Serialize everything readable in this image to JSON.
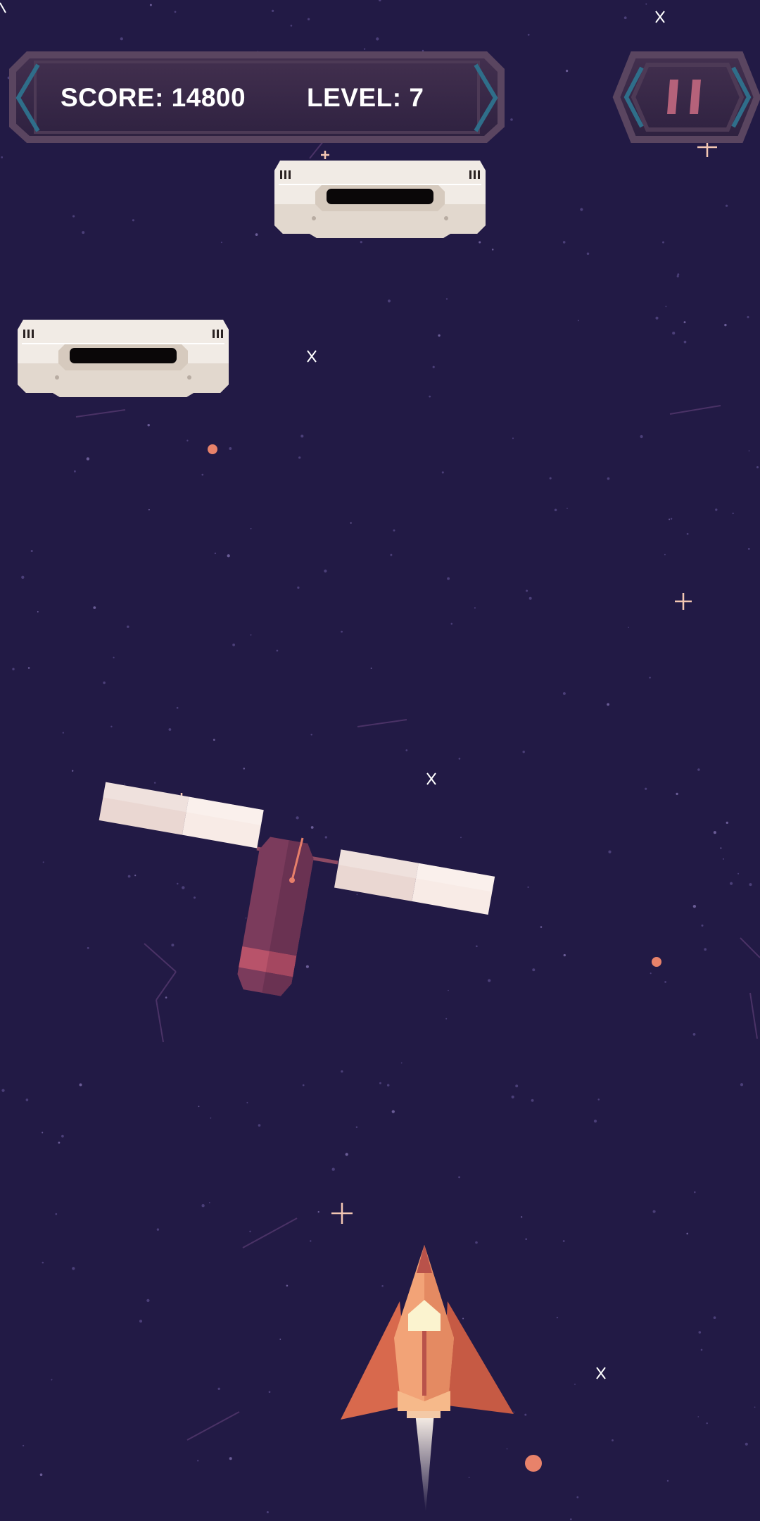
{
  "hud": {
    "score_label": "SCORE: 14800",
    "level_label": "LEVEL: 7"
  },
  "pause_button": {
    "icon": "pause-icon"
  },
  "game": {
    "platforms": 2,
    "obstacle": "satellite",
    "player": "rocket-ship"
  },
  "colors": {
    "background": "#221a45",
    "hud_panel": "#3b2a4a",
    "hud_border": "#5a4560",
    "hud_accent": "#2f6e8a",
    "platform": "#f2ece6",
    "rocket": "#e8906a",
    "satellite_body": "#7a3c5c",
    "satellite_panel": "#f4e6e2"
  }
}
